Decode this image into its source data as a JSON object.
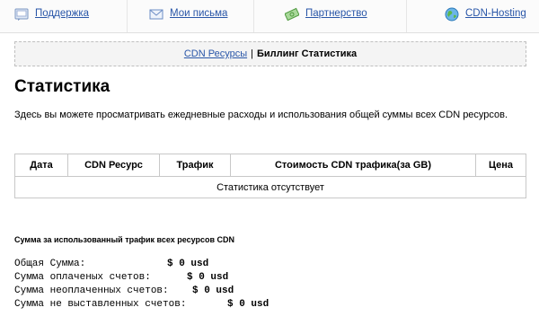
{
  "nav": {
    "items": [
      {
        "label": "Поддержка",
        "icon": "support-icon"
      },
      {
        "label": "Мои письма",
        "icon": "mail-icon"
      },
      {
        "label": "Партнерство",
        "icon": "money-icon"
      },
      {
        "label": "CDN-Hosting",
        "icon": "globe-icon"
      }
    ]
  },
  "breadcrumb": {
    "link": "CDN Ресурсы",
    "separator": "|",
    "current": "Биллинг Статистика"
  },
  "page": {
    "title": "Статистика",
    "description": "Здесь вы можете просматривать ежедневные расходы и использования общей суммы всех CDN ресурсов."
  },
  "table": {
    "columns": [
      "Дата",
      "CDN Ресурс",
      "Трафик",
      "Стоимость CDN трафика(за GB)",
      "Цена"
    ],
    "empty_message": "Статистика отсутствует"
  },
  "summary": {
    "title": "Сумма за использованный трафик всех ресурсов CDN",
    "rows": [
      {
        "label": "Общая Сумма:",
        "value": "$ 0 usd"
      },
      {
        "label": "Сумма оплаченых счетов:",
        "value": "$ 0 usd"
      },
      {
        "label": "Сумма неоплаченных счетов:",
        "value": "$ 0 usd"
      },
      {
        "label": "Сумма не выставленных счетов:",
        "value": "$ 0 usd"
      }
    ]
  }
}
